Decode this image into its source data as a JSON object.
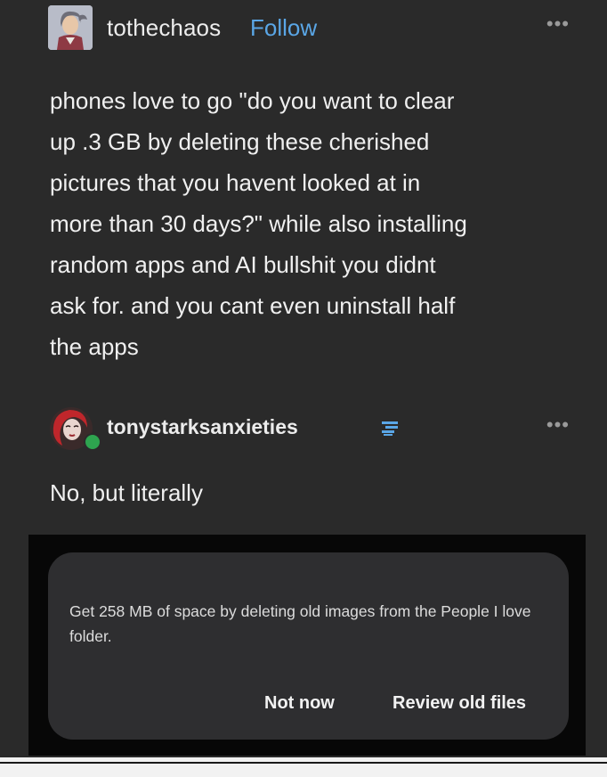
{
  "post": {
    "username": "tothechaos",
    "follow_label": "Follow",
    "more_label": "•••",
    "text": "phones love to go \"do you want to clear\nup .3 GB by deleting these cherished\npictures that you havent looked at in\nmore than 30 days?\" while also installing\nrandom apps and AI bullshit you didnt\nask for. and you cant even uninstall half\nthe apps"
  },
  "reply": {
    "username": "tonystarksanxieties",
    "more_label": "•••",
    "text": "No, but literally"
  },
  "dialog": {
    "message": "Get 258 MB of space by deleting old images from the People I love folder.",
    "not_now_label": "Not now",
    "review_label": "Review old files"
  },
  "colors": {
    "background": "#2a2a2a",
    "follow": "#5aa6e6",
    "dialog_bg": "#2e2e30",
    "badge": "#2ea44f"
  }
}
